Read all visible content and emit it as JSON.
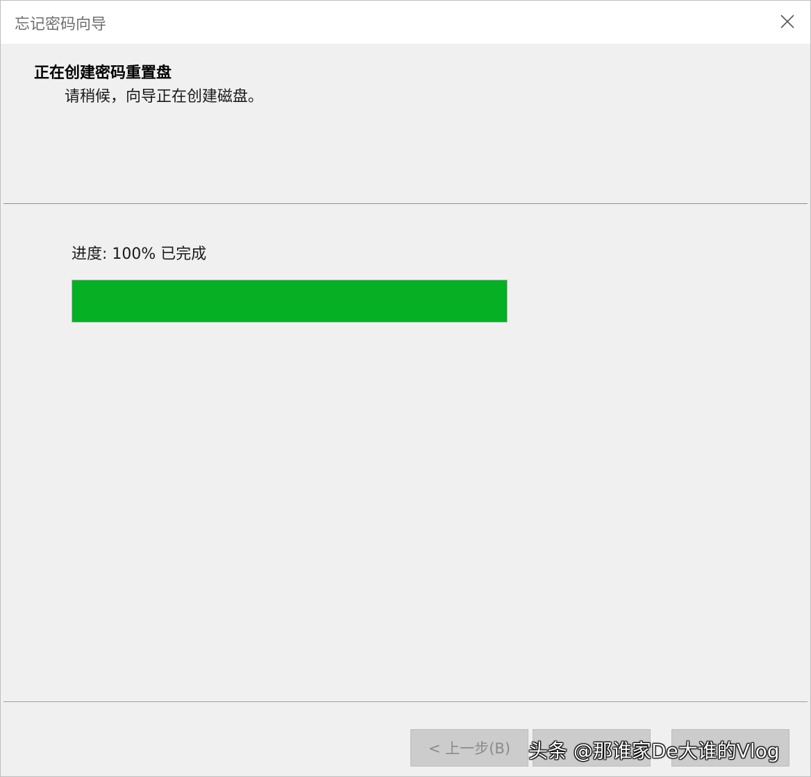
{
  "window": {
    "title": "忘记密码向导"
  },
  "header": {
    "title": "正在创建密码重置盘",
    "subtitle": "请稍候，向导正在创建磁盘。"
  },
  "progress": {
    "label": "进度: 100% 已完成",
    "percent": 100,
    "color": "#06b025"
  },
  "buttons": {
    "back_label": "< 上一步(B)",
    "next_label": "",
    "cancel_label": ""
  },
  "watermark": {
    "text": "头条 @那谁家De大谁的Vlog"
  },
  "icons": {
    "close": "close-icon"
  }
}
